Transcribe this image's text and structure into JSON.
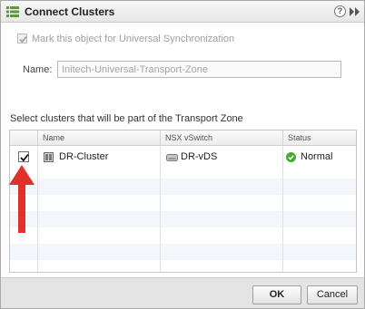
{
  "dialog": {
    "title": "Connect Clusters",
    "help_glyph": "?"
  },
  "universal_sync": {
    "label": "Mark this object for Universal Synchronization",
    "checked": true,
    "disabled": true
  },
  "name_field": {
    "label": "Name:",
    "value": "Initech-Universal-Transport-Zone"
  },
  "clusters": {
    "prompt": "Select clusters that will be part of the Transport Zone",
    "columns": [
      "Name",
      "NSX vSwitch",
      "Status"
    ],
    "rows": [
      {
        "selected": true,
        "name": "DR-Cluster",
        "vswitch": "DR-vDS",
        "status": "Normal"
      }
    ]
  },
  "colors": {
    "annotation_arrow": "#e2302b",
    "status_ok": "#3fae2a"
  },
  "icons": {
    "title": "grid-icon",
    "help": "help-icon",
    "expand": "expand-icon",
    "cluster": "cluster-icon",
    "vswitch": "vds-icon",
    "status": "status-ok-icon"
  },
  "footer": {
    "ok_label": "OK",
    "cancel_label": "Cancel"
  }
}
